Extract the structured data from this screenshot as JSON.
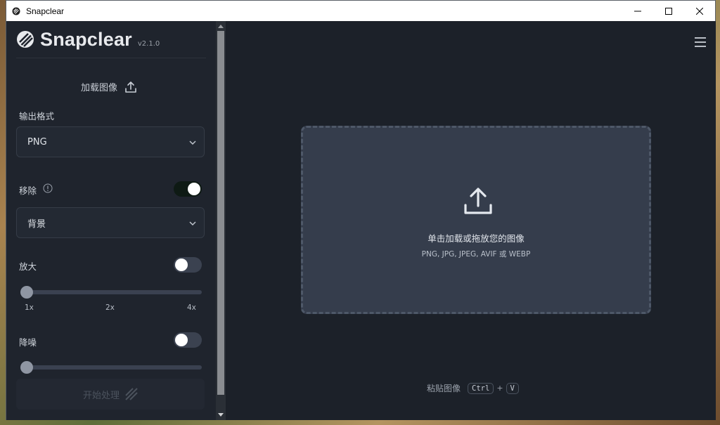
{
  "window": {
    "title": "Snapclear"
  },
  "brand": {
    "name": "Snapclear",
    "version": "v2.1.0"
  },
  "sidebar": {
    "load_image_label": "加载图像",
    "output_format_label": "输出格式",
    "output_format_value": "PNG",
    "remove_label": "移除",
    "remove_enabled": true,
    "remove_target_value": "背景",
    "upscale_label": "放大",
    "upscale_enabled": false,
    "upscale_ticks": [
      "1x",
      "2x",
      "4x"
    ],
    "upscale_value": "1x",
    "denoise_label": "降噪",
    "denoise_enabled": false,
    "process_button_label": "开始处理"
  },
  "main": {
    "dropzone_title": "单击加载或拖放您的图像",
    "dropzone_formats": "PNG, JPG, JPEG, AVIF 或 WEBP",
    "paste_label": "粘贴图像",
    "paste_keys": [
      "Ctrl",
      "V"
    ],
    "paste_plus": "+"
  },
  "colors": {
    "sidebar_bg": "#1f242d",
    "main_bg": "#1c2129",
    "dropzone_bg": "#353d4c",
    "toggle_on": "#0e1a14",
    "toggle_off": "#3b4250"
  },
  "icons": [
    "app-icon",
    "minimize-icon",
    "maximize-icon",
    "close-icon",
    "logo-icon",
    "upload-icon",
    "chevron-down-icon",
    "info-icon",
    "hamburger-menu-icon",
    "process-stripes-icon"
  ]
}
